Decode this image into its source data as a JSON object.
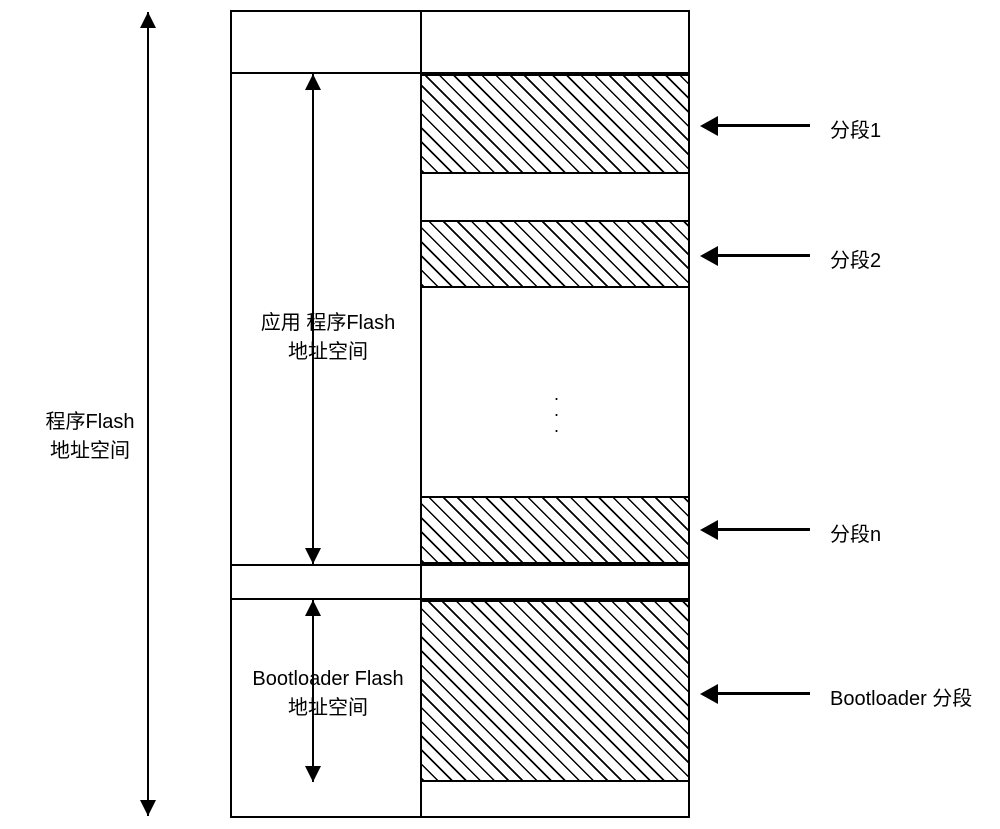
{
  "labels": {
    "outer": "程序Flash\n地址空间",
    "app": "应用 程序Flash\n地址空间",
    "boot": "Bootloader Flash\n地址空间"
  },
  "pointers": {
    "seg1": "分段1",
    "seg2": "分段2",
    "segn": "分段n",
    "boot": "Bootloader 分段"
  }
}
